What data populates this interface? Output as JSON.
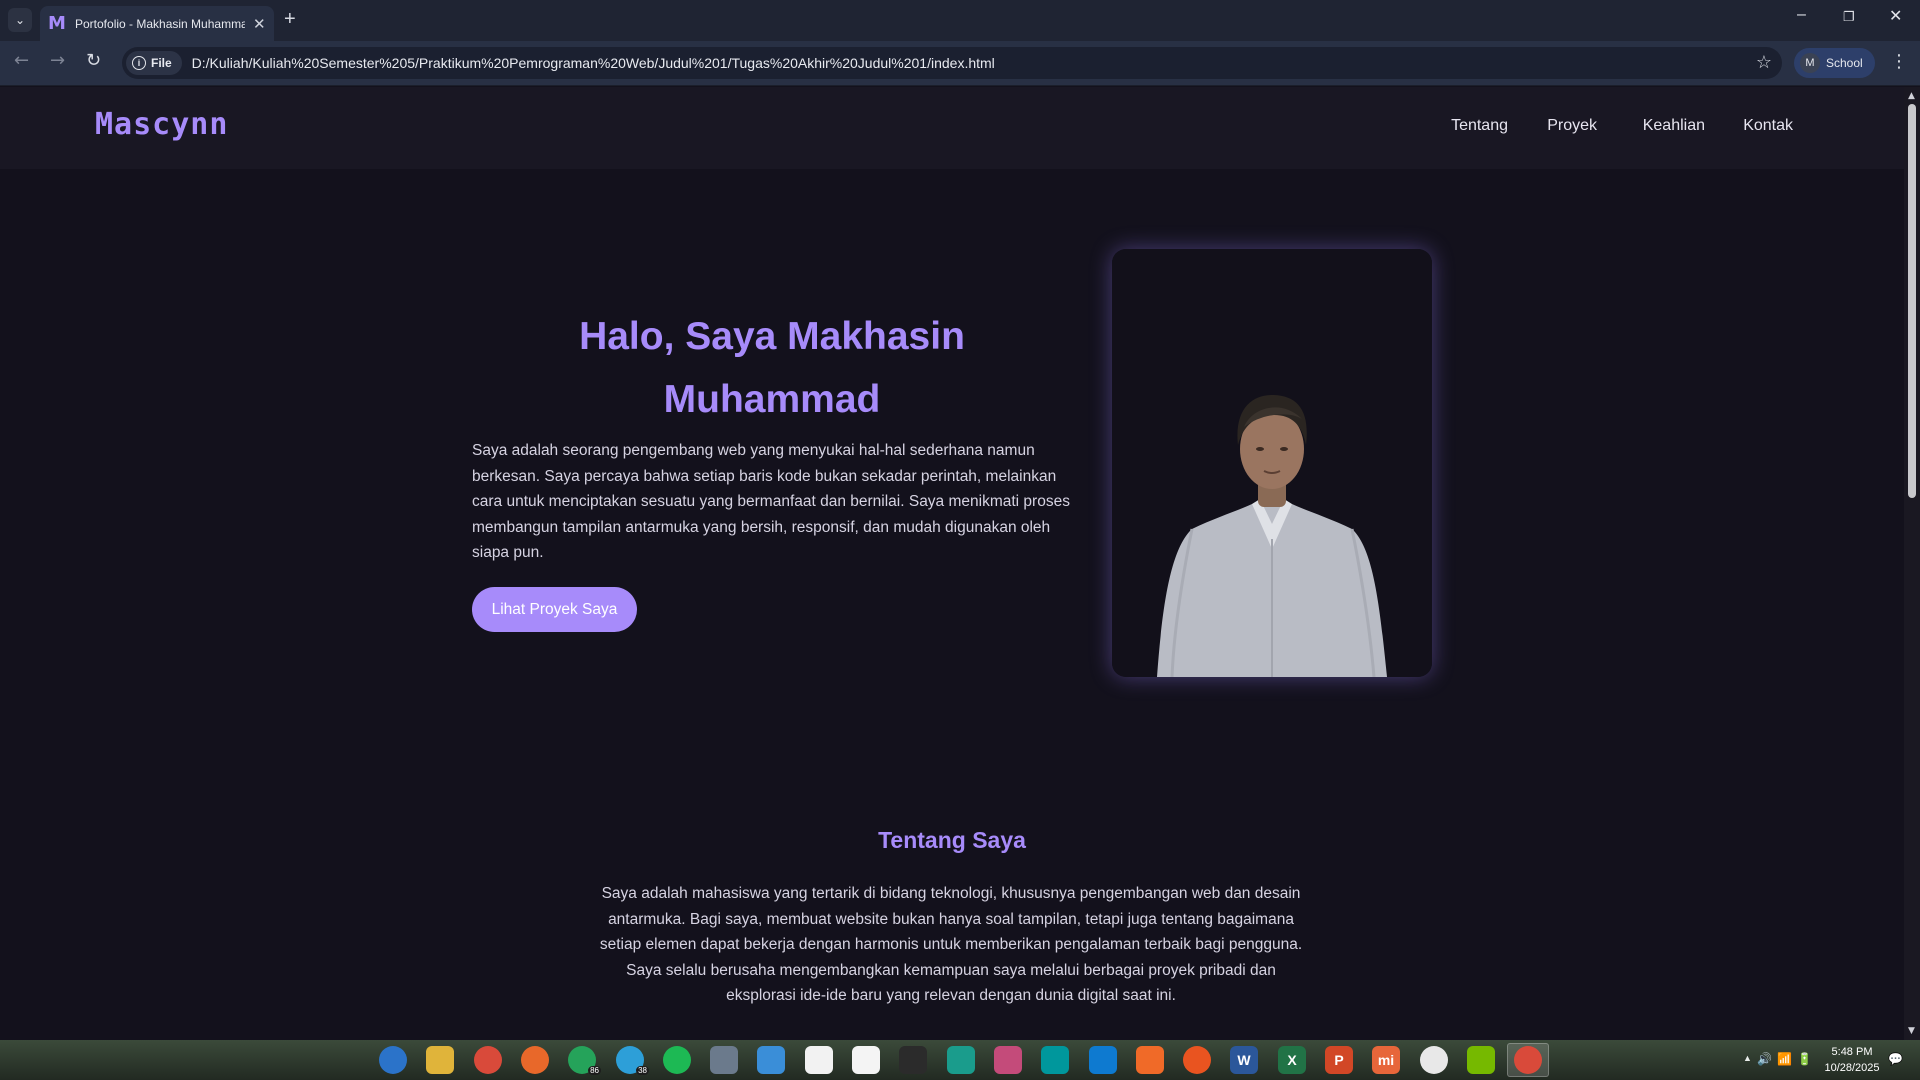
{
  "browser": {
    "tab_title": "Portofolio - Makhasin Muhammad",
    "tab_favicon": "M",
    "site_chip_label": "File",
    "url": "D:/Kuliah/Kuliah%20Semester%205/Praktikum%20Pemrograman%20Web/Judul%201/Tugas%20Akhir%20Judul%201/index.html",
    "profile_initial": "M",
    "profile_name": "School",
    "tab_close_glyph": "✕",
    "new_tab_glyph": "+",
    "minimize_glyph": "–",
    "restore_glyph": "❐",
    "close_glyph": "✕",
    "back_glyph": "←",
    "forward_glyph": "→",
    "reload_glyph": "↻",
    "star_glyph": "☆",
    "menu_glyph": "⋮",
    "tabs_menu_glyph": "⌄"
  },
  "site": {
    "logo_main": "Mascynn",
    "nav": [
      "Tentang",
      "Proyek",
      "Keahlian",
      "Kontak"
    ],
    "hero_title": "Halo, Saya Makhasin Muhammad",
    "hero_text": "Saya adalah seorang pengembang web yang menyukai hal-hal sederhana namun berkesan. Saya percaya bahwa setiap baris kode bukan sekadar perintah, melainkan cara untuk menciptakan sesuatu yang bermanfaat dan bernilai. Saya menikmati proses membangun tampilan antarmuka yang bersih, responsif, dan mudah digunakan oleh siapa pun.",
    "cta_label": "Lihat Proyek Saya",
    "about_title": "Tentang Saya",
    "about_text": "Saya adalah mahasiswa yang tertarik di bidang teknologi, khususnya pengembangan web dan desain antarmuka. Bagi saya, membuat website bukan hanya soal tampilan, tetapi juga tentang bagaimana setiap elemen dapat bekerja dengan harmonis untuk memberikan pengalaman terbaik bagi pengguna. Saya selalu berusaha mengembangkan kemampuan saya melalui berbagai proyek pribadi dan eksplorasi ide-ide baru yang relevan dengan dunia digital saat ini.",
    "accent_color": "#a78bfa",
    "background_color": "#13111c"
  },
  "taskbar": {
    "apps": [
      {
        "name": "start",
        "label": "",
        "color": "#2b73c9"
      },
      {
        "name": "file-explorer",
        "label": "",
        "color": "#e0b43a"
      },
      {
        "name": "chrome",
        "label": "",
        "color": "#d94a3a"
      },
      {
        "name": "firefox",
        "label": "",
        "color": "#e8682a"
      },
      {
        "name": "whatsapp",
        "label": "",
        "color": "#25a35a",
        "badge": "86"
      },
      {
        "name": "telegram",
        "label": "",
        "color": "#2d9fd8",
        "badge": "38"
      },
      {
        "name": "spotify",
        "label": "",
        "color": "#1db954"
      },
      {
        "name": "calculator",
        "label": "",
        "color": "#6b7a8c"
      },
      {
        "name": "notepad",
        "label": "",
        "color": "#3a8ed8"
      },
      {
        "name": "paint",
        "label": "",
        "color": "#f2f2f2"
      },
      {
        "name": "store",
        "label": "",
        "color": "#f4f4f4"
      },
      {
        "name": "terminal",
        "label": "",
        "color": "#2b2b2b"
      },
      {
        "name": "visual-studio-code-insiders",
        "label": "",
        "color": "#1a9c8c"
      },
      {
        "name": "app-rgb",
        "label": "",
        "color": "#c44b7a"
      },
      {
        "name": "arduino",
        "label": "",
        "color": "#00979c"
      },
      {
        "name": "vscode",
        "label": "",
        "color": "#0e7ad0"
      },
      {
        "name": "pen-app",
        "label": "",
        "color": "#f06a28"
      },
      {
        "name": "ubuntu",
        "label": "",
        "color": "#e95420"
      },
      {
        "name": "word",
        "label": "W",
        "color": "#2b579a"
      },
      {
        "name": "excel",
        "label": "X",
        "color": "#217346"
      },
      {
        "name": "powerpoint",
        "label": "P",
        "color": "#d24726"
      },
      {
        "name": "mi",
        "label": "mi",
        "color": "#e7663a"
      },
      {
        "name": "clock-app",
        "label": "",
        "color": "#e8e8e8"
      },
      {
        "name": "gpu-app",
        "label": "",
        "color": "#76b900"
      },
      {
        "name": "chrome-profile",
        "label": "",
        "color": "#d94a3a",
        "active": true
      }
    ],
    "time": "5:48 PM",
    "date": "10/28/2025",
    "tray_up_glyph": "▲"
  }
}
